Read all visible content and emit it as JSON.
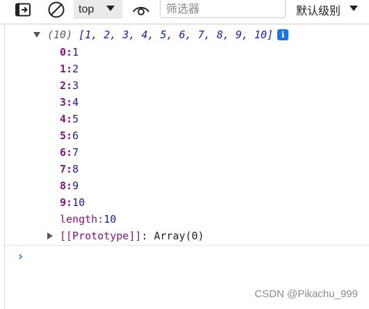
{
  "toolbar": {
    "context": "top",
    "filter_placeholder": "筛选器",
    "levels": "默认级别",
    "icons": [
      "dock-panel-icon",
      "clear-console-icon",
      "chevron-down-icon",
      "live-expression-eye-icon",
      "chevron-down-icon"
    ]
  },
  "console": {
    "array_summary": {
      "count": "(10)",
      "preview": "[1, 2, 3, 4, 5, 6, 7, 8, 9, 10]"
    },
    "items": [
      {
        "key": "0:",
        "value": "1"
      },
      {
        "key": "1:",
        "value": "2"
      },
      {
        "key": "2:",
        "value": "3"
      },
      {
        "key": "3:",
        "value": "4"
      },
      {
        "key": "4:",
        "value": "5"
      },
      {
        "key": "5:",
        "value": "6"
      },
      {
        "key": "6:",
        "value": "7"
      },
      {
        "key": "7:",
        "value": "8"
      },
      {
        "key": "8:",
        "value": "9"
      },
      {
        "key": "9:",
        "value": "10"
      }
    ],
    "length": {
      "key": "length:",
      "value": "10"
    },
    "prototype": {
      "key": "[[Prototype]]",
      "value": ": Array(0)"
    },
    "prompt": "›"
  },
  "watermark": "CSDN @Pikachu_999",
  "colors": {
    "key": "#881280",
    "value": "#1a1aa6",
    "accent": "#1a73e8"
  }
}
